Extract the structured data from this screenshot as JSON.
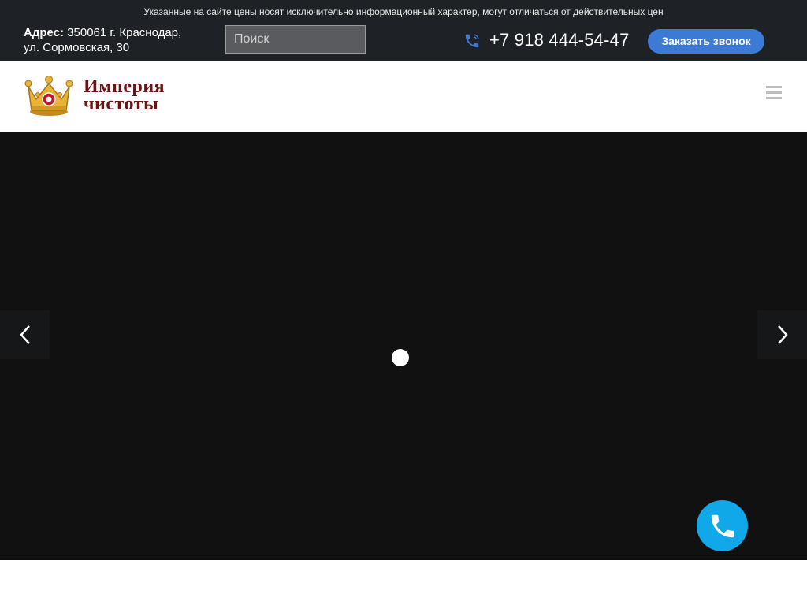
{
  "topbar": {
    "notice": "Указанные на сайте цены носят исключительно информационный характер, могут отличаться от действительных цен",
    "address_label": "Адрес:",
    "address_line1": " 350061 г. Краснодар,",
    "address_line2": "ул. Сормовская, 30",
    "search_placeholder": "Поиск",
    "phone": "+7 918 444-54-47",
    "callback_label": "Заказать звонок"
  },
  "header": {
    "logo_line1": "Империя",
    "logo_line2": "чистоты",
    "menu_icon": "hamburger-menu-icon"
  },
  "slider": {
    "prev_icon": "chevron-left-icon",
    "next_icon": "chevron-right-icon",
    "loader": "loading-spinner"
  },
  "floating": {
    "call_icon": "phone-icon"
  },
  "colors": {
    "topbar_bg": "#1e2125",
    "accent_blue": "#3d7ad6",
    "float_call": "#10a8e8",
    "logo_red": "#6b1414",
    "hero_bg": "#111112"
  }
}
